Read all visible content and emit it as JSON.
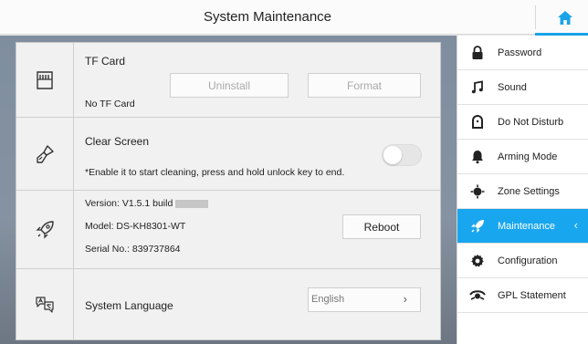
{
  "header": {
    "title": "System Maintenance"
  },
  "main": {
    "tf_card": {
      "title": "TF Card",
      "status": "No TF Card",
      "uninstall_label": "Uninstall",
      "format_label": "Format"
    },
    "clear_screen": {
      "title": "Clear Screen",
      "description": "*Enable it to start cleaning, press and hold unlock key to end."
    },
    "device_info": {
      "version": "Version: V1.5.1 build",
      "model": "Model: DS-KH8301-WT",
      "serial": "Serial No.: 839737864",
      "reboot_label": "Reboot"
    },
    "language": {
      "title": "System Language",
      "selected": "English",
      "chevron": "›"
    }
  },
  "sidebar": {
    "items": [
      {
        "label": "Password",
        "icon": "lock-icon"
      },
      {
        "label": "Sound",
        "icon": "music-note-icon"
      },
      {
        "label": "Do Not Disturb",
        "icon": "do-not-disturb-icon"
      },
      {
        "label": "Arming Mode",
        "icon": "bell-icon"
      },
      {
        "label": "Zone Settings",
        "icon": "zone-target-icon"
      },
      {
        "label": "Maintenance",
        "icon": "rocket-icon",
        "active": true,
        "chevron": "‹"
      },
      {
        "label": "Configuration",
        "icon": "gear-icon"
      },
      {
        "label": "GPL Statement",
        "icon": "gpl-eye-icon"
      }
    ]
  },
  "colors": {
    "accent": "#18a6ee",
    "panel_bg": "#f1f1f1",
    "backdrop": "#7f8e9f"
  }
}
